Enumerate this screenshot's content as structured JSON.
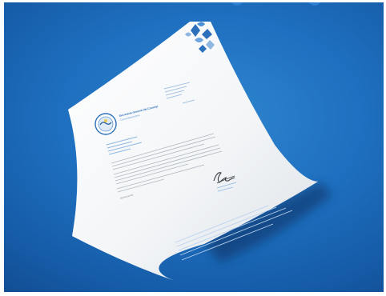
{
  "letterhead": {
    "organization_name": "Secretaría General del Consejo",
    "organization_subline": "Comunidad Andina",
    "recipient_block": "",
    "body_text": "",
    "closing": "Atentamente,"
  },
  "colors": {
    "background_top": "#2f86d0",
    "background_bottom": "#114b90",
    "paper": "#f4f6f8",
    "accent_blue": "#2c6fba",
    "accent_light": "#8fb7e2",
    "text_gray": "#9aa3ad"
  },
  "icons": {
    "seal": "circular-organization-seal",
    "corner_decoration": "blue-geometric-corner-pattern",
    "signature": "handwritten-signature"
  }
}
